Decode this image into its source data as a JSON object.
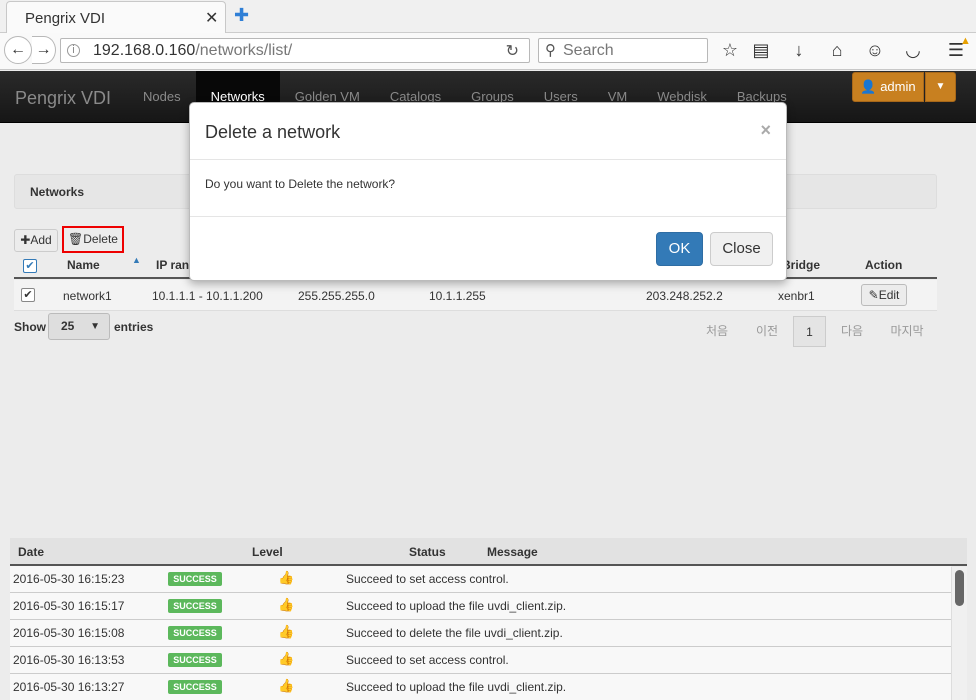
{
  "browser": {
    "tab_title": "Pengrix VDI",
    "url_host": "192.168.0.160",
    "url_path": "/networks/list/",
    "search_placeholder": "Search"
  },
  "nav": {
    "brand": "Pengrix VDI",
    "links": [
      "Nodes",
      "Networks",
      "Golden VM",
      "Catalogs",
      "Groups",
      "Users",
      "VM",
      "Webdisk",
      "Backups"
    ],
    "active": "Networks",
    "user": "admin"
  },
  "panel": {
    "title": "Networks"
  },
  "toolbar": {
    "add_label": "Add",
    "delete_label": "Delete"
  },
  "table": {
    "headers": [
      "Name",
      "IP ran",
      "Bridge",
      "Action"
    ],
    "row": {
      "name": "network1",
      "ip_range": "10.1.1.1 - 10.1.1.200",
      "netmask": "255.255.255.0",
      "broadcast": "10.1.1.255",
      "dns": "203.248.252.2",
      "bridge": "xenbr1",
      "edit": "Edit"
    }
  },
  "length": {
    "show": "Show",
    "value": "25",
    "entries": "entries"
  },
  "pagination": {
    "first": "처음",
    "prev": "이전",
    "current": "1",
    "next": "다음",
    "last": "마지막"
  },
  "modal": {
    "title": "Delete a network",
    "close_x": "×",
    "body": "Do you want to Delete the network?",
    "ok": "OK",
    "close": "Close"
  },
  "log": {
    "headers": [
      "Date",
      "Level",
      "Status",
      "Message"
    ],
    "rows": [
      {
        "date": "2016-05-30 16:15:23",
        "status": "SUCCESS",
        "message": "Succeed to set access control."
      },
      {
        "date": "2016-05-30 16:15:17",
        "status": "SUCCESS",
        "message": "Succeed to upload the file uvdi_client.zip."
      },
      {
        "date": "2016-05-30 16:15:08",
        "status": "SUCCESS",
        "message": "Succeed to delete the file uvdi_client.zip."
      },
      {
        "date": "2016-05-30 16:13:53",
        "status": "SUCCESS",
        "message": "Succeed to set access control."
      },
      {
        "date": "2016-05-30 16:13:27",
        "status": "SUCCESS",
        "message": "Succeed to upload the file uvdi_client.zip."
      }
    ]
  },
  "colors": {
    "accent": "#337ab7",
    "admin": "#c88020",
    "success": "#5cb85c",
    "highlight": "#ee0000"
  }
}
